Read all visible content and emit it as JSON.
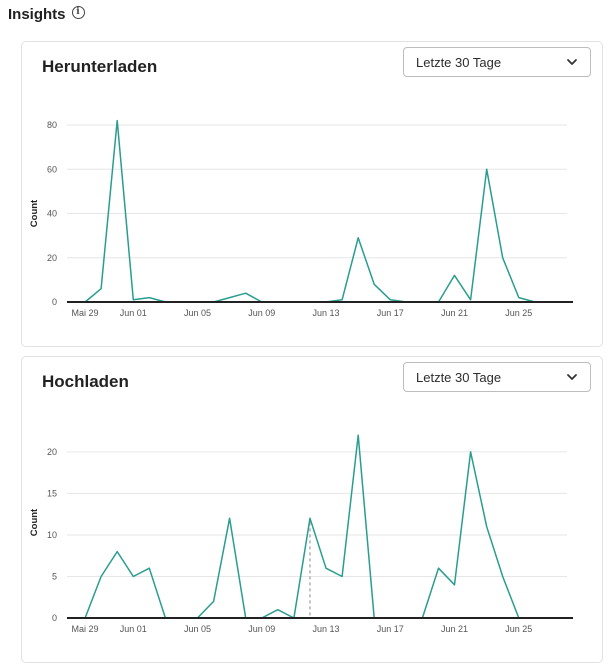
{
  "page": {
    "title": "Insights",
    "info_icon": "info-icon"
  },
  "colors": {
    "series": "#2a9d8f",
    "grid": "#e6e6e6",
    "baseline": "#222222"
  },
  "cards": [
    {
      "id": "downloads",
      "title": "Herunterladen",
      "range_select": {
        "value": "Letzte 30 Tage",
        "icon": "chevron-down-icon"
      }
    },
    {
      "id": "uploads",
      "title": "Hochladen",
      "range_select": {
        "value": "Letzte 30 Tage",
        "icon": "chevron-down-icon"
      }
    }
  ],
  "chart_data": [
    {
      "type": "line",
      "ylabel": "Count",
      "ylim": [
        0,
        80
      ],
      "yticks": [
        0,
        20,
        40,
        60,
        80
      ],
      "grid": true,
      "x_tick_labels": [
        "Mai 29",
        "Jun 01",
        "Jun 05",
        "Jun 09",
        "Jun 13",
        "Jun 17",
        "Jun 21",
        "Jun 25"
      ],
      "x_tick_index": [
        1,
        4,
        8,
        12,
        16,
        20,
        24,
        28
      ],
      "series": [
        {
          "values": [
            0,
            0,
            6,
            82,
            1,
            2,
            0,
            0,
            0,
            0,
            2,
            4,
            0,
            0,
            0,
            0,
            0,
            1,
            29,
            8,
            1,
            0,
            0,
            0,
            12,
            1,
            60,
            20,
            2,
            0,
            0,
            0
          ]
        }
      ]
    },
    {
      "type": "line",
      "ylabel": "Count",
      "ylim": [
        0,
        23
      ],
      "yticks": [
        0,
        5,
        10,
        15,
        20
      ],
      "grid": true,
      "x_tick_labels": [
        "Mai 29",
        "Jun 01",
        "Jun 05",
        "Jun 09",
        "Jun 13",
        "Jun 17",
        "Jun 21",
        "Jun 25"
      ],
      "x_tick_index": [
        1,
        4,
        8,
        12,
        16,
        20,
        24,
        28
      ],
      "series": [
        {
          "values": [
            0,
            0,
            5,
            8,
            5,
            6,
            0,
            0,
            0,
            2,
            12,
            0,
            0,
            1,
            0,
            12,
            6,
            5,
            22,
            0,
            0,
            0,
            0,
            6,
            4,
            20,
            11,
            5,
            0,
            0,
            0,
            0
          ]
        }
      ]
    }
  ]
}
